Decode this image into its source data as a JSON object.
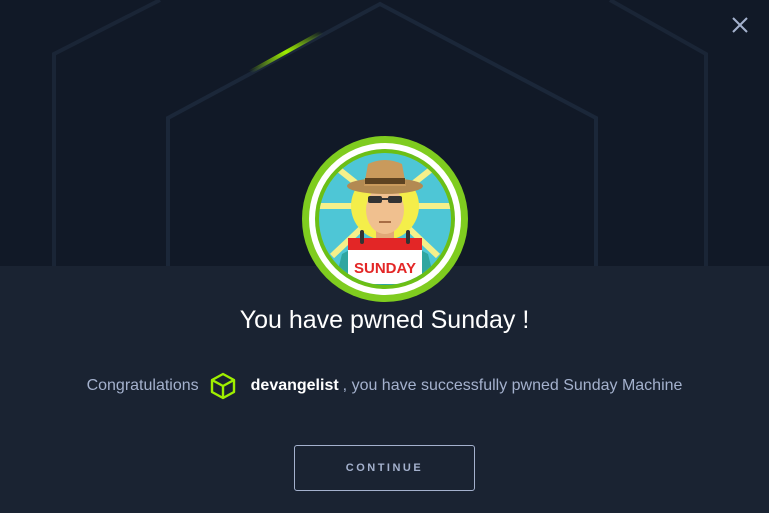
{
  "modal": {
    "title": "You have pwned Sunday !",
    "congrats_prefix": "Congratulations",
    "username": "devangelist",
    "congrats_suffix": ", you have successfully pwned Sunday Machine",
    "continue_label": "CONTINUE",
    "badge_calendar_text": "SUNDAY"
  },
  "icons": {
    "close": "close-icon",
    "user_rank": "cube-icon"
  },
  "colors": {
    "background_top": "#111927",
    "background_bottom": "#1a2332",
    "accent_green": "#9fef00",
    "text_muted": "#a4b1cd",
    "text_white": "#ffffff"
  }
}
